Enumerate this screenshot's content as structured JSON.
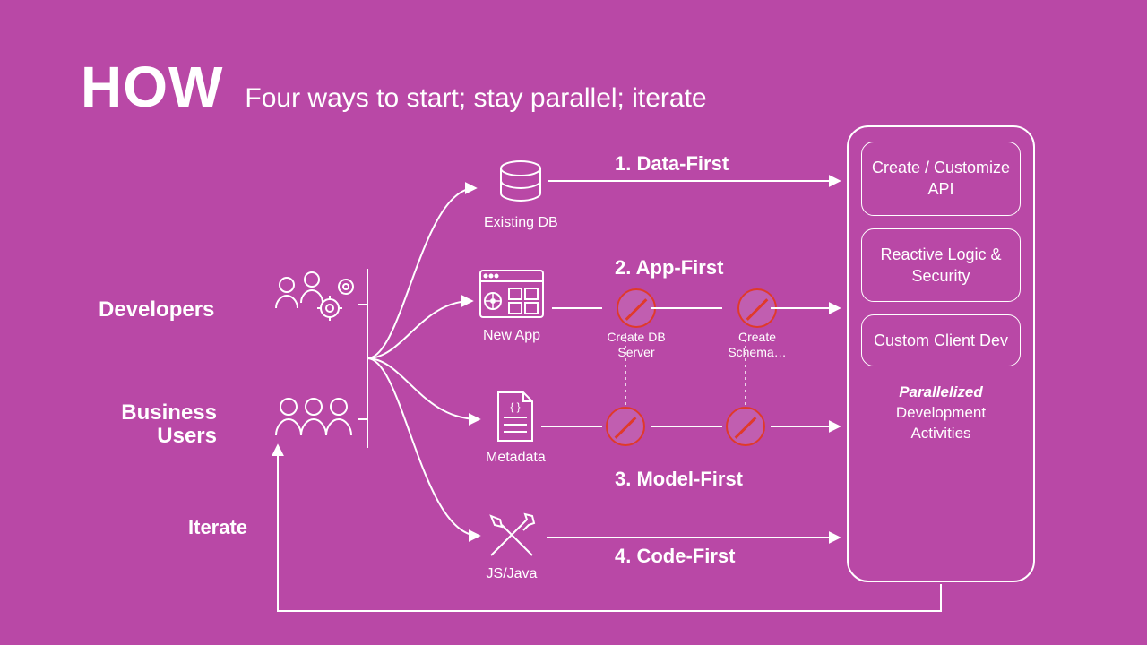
{
  "title": "HOW",
  "subtitle": "Four ways to start; stay parallel; iterate",
  "roles": {
    "developers": "Developers",
    "business_users": "Business Users",
    "iterate": "Iterate"
  },
  "starting_points": {
    "existing_db": "Existing DB",
    "new_app": "New App",
    "metadata": "Metadata",
    "js_java": "JS/Java"
  },
  "approaches": {
    "data_first": "1. Data-First",
    "app_first": "2. App-First",
    "model_first": "3. Model-First",
    "code_first": "4. Code-First"
  },
  "intermediate_steps": {
    "create_db_server": "Create DB Server",
    "create_schema": "Create Schema…"
  },
  "right_panel": {
    "box_api": "Create / Customize API",
    "box_logic": "Reactive Logic & Security",
    "box_client": "Custom Client Dev",
    "caption_ital": "Parallelized",
    "caption_line2": "Development",
    "caption_line3": "Activities"
  }
}
